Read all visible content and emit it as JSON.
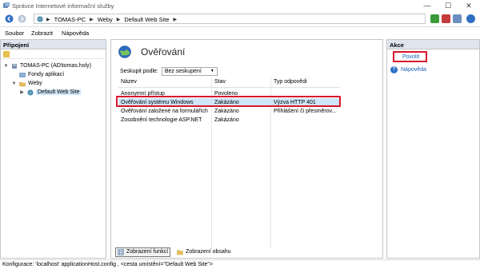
{
  "window": {
    "title": "Správce Internetové informační služby",
    "controls": [
      "—",
      "☐",
      "✕"
    ]
  },
  "address": {
    "crumbs": [
      "TOMAS-PC",
      "Weby",
      "Default Web Site"
    ]
  },
  "menu": [
    "Soubor",
    "Zobrazit",
    "Nápověda"
  ],
  "connections": {
    "header": "Připojení",
    "tree": [
      {
        "label": "TOMAS-PC (AD\\tomas.holy)",
        "icon": "server-icon"
      },
      {
        "label": "Fondy aplikací",
        "icon": "app-pool-icon"
      },
      {
        "label": "Weby",
        "icon": "folder-icon"
      },
      {
        "label": "Default Web Site",
        "icon": "globe-icon"
      }
    ]
  },
  "main": {
    "title": "Ověřování",
    "groupby_label": "Seskupit podle:",
    "groupby_value": "Bez seskupení",
    "columns": [
      "Název",
      "Stav",
      "Typ odpovědi"
    ],
    "rows": [
      {
        "name": "Anonymní přístup",
        "status": "Povoleno",
        "type": ""
      },
      {
        "name": "Ověřování systému Windows",
        "status": "Zakázáno",
        "type": "Výzva HTTP 401"
      },
      {
        "name": "Ověřování založené na formulářích",
        "status": "Zakázáno",
        "type": "Přihlášení či přesměrov..."
      },
      {
        "name": "Zosobnění technologie ASP.NET",
        "status": "Zakázáno",
        "type": ""
      }
    ],
    "tabs": [
      "Zobrazení funkcí",
      "Zobrazení obsahu"
    ]
  },
  "actions": {
    "header": "Akce",
    "enable": "Povolit",
    "help": "Nápověda"
  },
  "status": "Konfigurace: 'localhost' applicationHost.config , <cesta umístění=\"Default Web Site\">",
  "colors": {
    "highlight_red": "#d9162b",
    "selection_blue": "#cfe5f9",
    "pane_header": "#dfe6ef",
    "link_blue": "#1a5fb4"
  }
}
